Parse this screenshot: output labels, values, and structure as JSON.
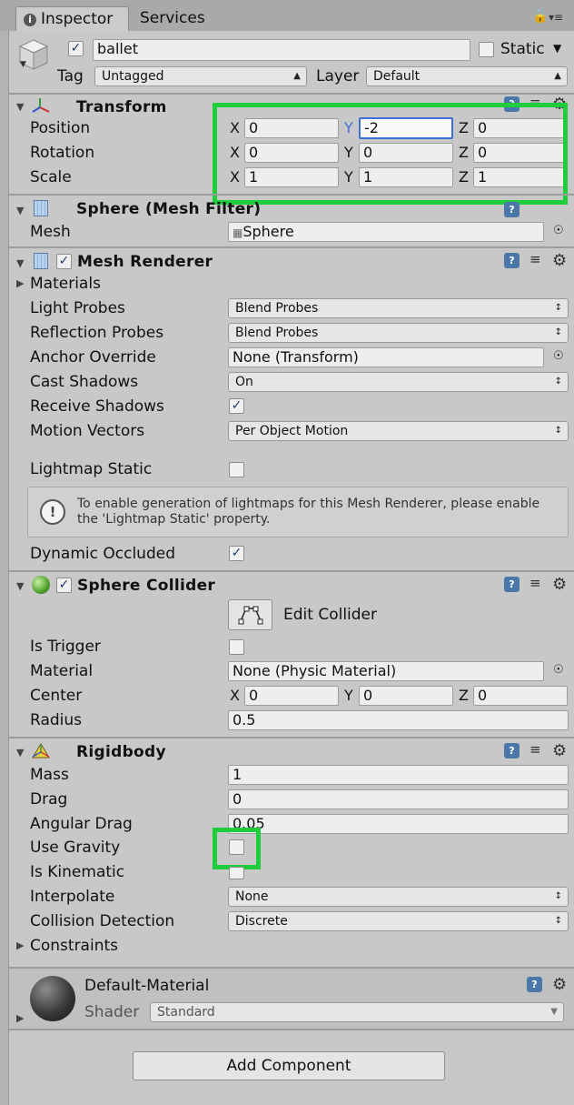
{
  "tabs": {
    "inspector": "Inspector",
    "services": "Services"
  },
  "object": {
    "name": "ballet",
    "static_label": "Static",
    "tag_label": "Tag",
    "tag_value": "Untagged",
    "layer_label": "Layer",
    "layer_value": "Default"
  },
  "transform": {
    "title": "Transform",
    "position_label": "Position",
    "rotation_label": "Rotation",
    "scale_label": "Scale",
    "axis_x": "X",
    "axis_y": "Y",
    "axis_z": "Z",
    "position": [
      "0",
      "-2",
      "0"
    ],
    "rotation": [
      "0",
      "0",
      "0"
    ],
    "scale": [
      "1",
      "1",
      "1"
    ]
  },
  "mesh_filter": {
    "title": "Sphere (Mesh Filter)",
    "mesh_label": "Mesh",
    "mesh_value": "Sphere"
  },
  "mesh_renderer": {
    "title": "Mesh Renderer",
    "materials": "Materials",
    "light_probes_label": "Light Probes",
    "light_probes_value": "Blend Probes",
    "reflection_probes_label": "Reflection Probes",
    "reflection_probes_value": "Blend Probes",
    "anchor_override_label": "Anchor Override",
    "anchor_override_value": "None (Transform)",
    "cast_shadows_label": "Cast Shadows",
    "cast_shadows_value": "On",
    "receive_shadows_label": "Receive Shadows",
    "motion_vectors_label": "Motion Vectors",
    "motion_vectors_value": "Per Object Motion",
    "lightmap_static_label": "Lightmap Static",
    "info_line1": "To enable generation of lightmaps for this Mesh Renderer, please enable",
    "info_line2": "the 'Lightmap Static' property.",
    "dynamic_occluded_label": "Dynamic Occluded"
  },
  "sphere_collider": {
    "title": "Sphere Collider",
    "edit_collider": "Edit Collider",
    "is_trigger_label": "Is Trigger",
    "material_label": "Material",
    "material_value": "None (Physic Material)",
    "center_label": "Center",
    "center": [
      "0",
      "0",
      "0"
    ],
    "radius_label": "Radius",
    "radius_value": "0.5"
  },
  "rigidbody": {
    "title": "Rigidbody",
    "mass_label": "Mass",
    "mass_value": "1",
    "drag_label": "Drag",
    "drag_value": "0",
    "angular_drag_label": "Angular Drag",
    "angular_drag_value": "0.05",
    "use_gravity_label": "Use Gravity",
    "is_kinematic_label": "Is Kinematic",
    "interpolate_label": "Interpolate",
    "interpolate_value": "None",
    "collision_detection_label": "Collision Detection",
    "collision_detection_value": "Discrete",
    "constraints_label": "Constraints"
  },
  "material": {
    "name": "Default-Material",
    "shader_label": "Shader",
    "shader_value": "Standard"
  },
  "add_component": "Add Component",
  "colors": {
    "highlight": "#1fcd3c",
    "focus": "#3d6fd8"
  }
}
